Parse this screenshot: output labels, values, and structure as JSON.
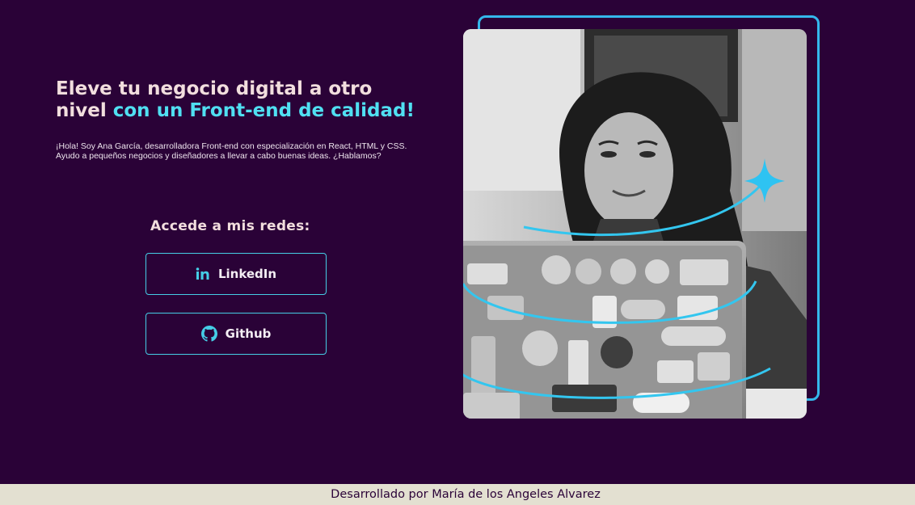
{
  "hero": {
    "headline_part1": "Eleve tu negocio digital a otro nivel ",
    "headline_part2": "con un Front-end de calidad!",
    "intro": "¡Hola! Soy Ana García, desarrolladora Front-end con especialización en React, HTML y CSS. Ayudo a pequeños negocios y diseñadores a llevar a cabo buenas ideas. ¿Hablamos?"
  },
  "social": {
    "title": "Accede a mis redes:",
    "buttons": [
      {
        "label": "LinkedIn",
        "icon": "linkedin-icon"
      },
      {
        "label": "Github",
        "icon": "github-icon"
      }
    ]
  },
  "footer": {
    "text": "Desarrollado por María de los Angeles Alvarez"
  },
  "colors": {
    "background": "#2a0237",
    "accent": "#50e0f2",
    "heading": "#f2dede",
    "frame": "#34b8ec",
    "footer_bg": "#e3e0d1"
  }
}
